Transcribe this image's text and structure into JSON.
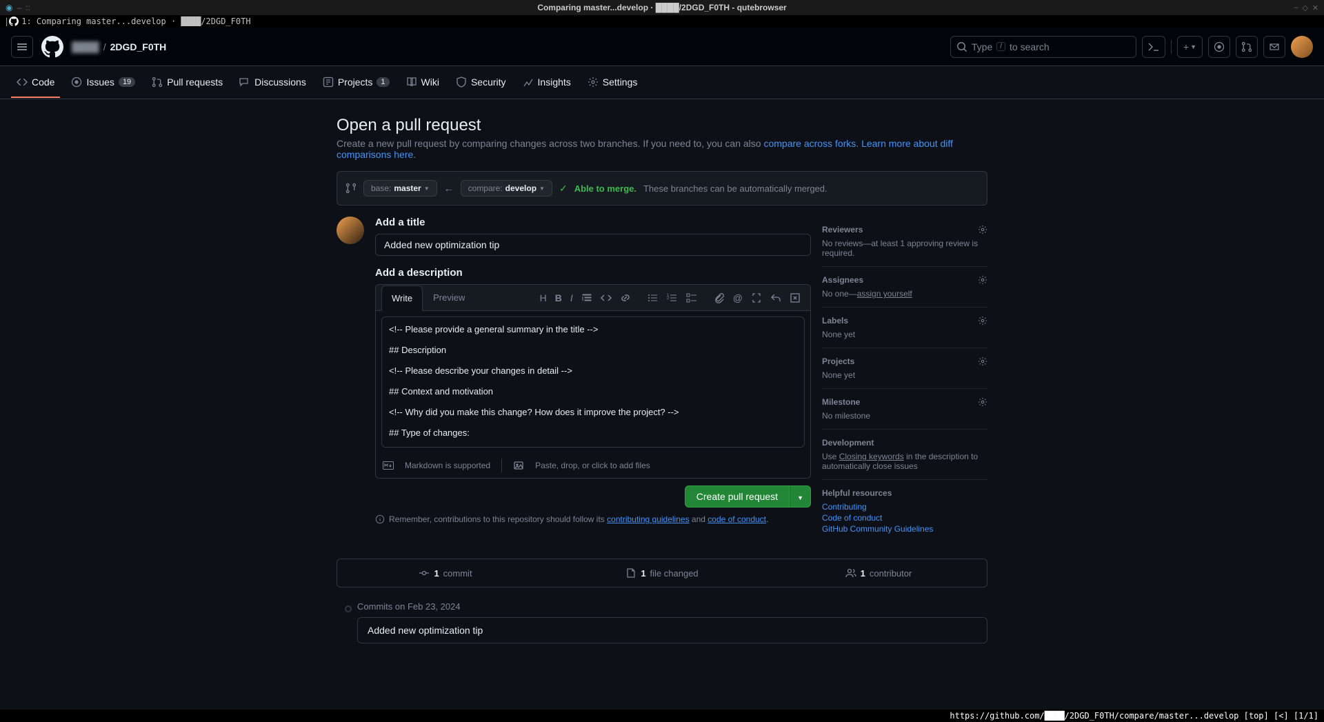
{
  "window": {
    "title": "Comparing master...develop · ████/2DGD_F0TH - qutebrowser"
  },
  "tabbar": {
    "text": "1: Comparing master...develop · ████/2DGD_F0TH"
  },
  "breadcrumb": {
    "owner": "████",
    "repo": "2DGD_F0TH"
  },
  "search": {
    "placeholder": "Type",
    "hint": "to search",
    "key": "/"
  },
  "nav": {
    "code": "Code",
    "issues": "Issues",
    "issues_count": "19",
    "pulls": "Pull requests",
    "discussions": "Discussions",
    "projects": "Projects",
    "projects_count": "1",
    "wiki": "Wiki",
    "security": "Security",
    "insights": "Insights",
    "settings": "Settings"
  },
  "page": {
    "title": "Open a pull request",
    "subtitle_a": "Create a new pull request by comparing changes across two branches. If you need to, you can also ",
    "subtitle_link1": "compare across forks",
    "subtitle_b": ". ",
    "subtitle_link2": "Learn more about diff comparisons here",
    "subtitle_c": "."
  },
  "compare": {
    "base_label": "base: ",
    "base": "master",
    "dots": "...",
    "compare_label": "compare: ",
    "compare": "develop",
    "ok": "Able to merge.",
    "ok_txt": "These branches can be automatically merged."
  },
  "form": {
    "title_label": "Add a title",
    "title_value": "Added new optimization tip",
    "desc_label": "Add a description",
    "write": "Write",
    "preview": "Preview",
    "body": "<!-- Please provide a general summary in the title -->\n\n## Description\n\n<!-- Please describe your changes in detail -->\n\n## Context and motivation\n\n<!-- Why did you make this change? How does it improve the project? -->\n\n## Type of changes:",
    "md_support": "Markdown is supported",
    "paste": "Paste, drop, or click to add files",
    "submit": "Create pull request",
    "note_a": "Remember, contributions to this repository should follow its ",
    "note_link1": "contributing guidelines",
    "note_b": " and ",
    "note_link2": "code of conduct",
    "note_c": "."
  },
  "sidebar": {
    "reviewers": {
      "h": "Reviewers",
      "b": "No reviews—at least 1 approving review is required."
    },
    "assignees": {
      "h": "Assignees",
      "b_a": "No one—",
      "b_link": "assign yourself"
    },
    "labels": {
      "h": "Labels",
      "b": "None yet"
    },
    "projects": {
      "h": "Projects",
      "b": "None yet"
    },
    "milestone": {
      "h": "Milestone",
      "b": "No milestone"
    },
    "development": {
      "h": "Development",
      "b_a": "Use ",
      "b_link": "Closing keywords",
      "b_b": " in the description to automatically close issues"
    },
    "help": {
      "h": "Helpful resources",
      "l1": "Contributing",
      "l2": "Code of conduct",
      "l3": "GitHub Community Guidelines"
    }
  },
  "stats": {
    "commits": "commit",
    "commits_n": "1",
    "files": "file changed",
    "files_n": "1",
    "contribs": "contributor",
    "contribs_n": "1"
  },
  "commits": {
    "heading": "Commits on Feb 23, 2024",
    "item": "Added new optimization tip"
  },
  "statusbar": {
    "url": "https://github.com/████/2DGD_F0TH/compare/master...develop [top] [<] [1/1]"
  }
}
